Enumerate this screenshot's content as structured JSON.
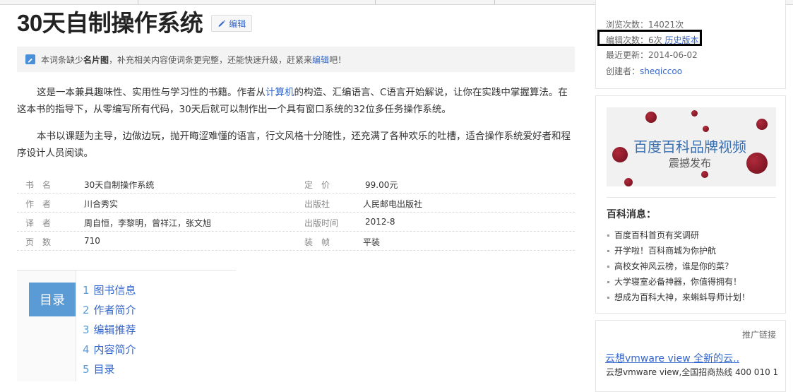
{
  "page": {
    "title": "30天自制操作系统",
    "edit_label": "编辑"
  },
  "notice": {
    "prefix": "本词条缺少",
    "bold": "名片图",
    "middle": "，补充相关内容使词条更完整，还能快速升级，赶紧来",
    "link": "编辑",
    "suffix": "吧！"
  },
  "intro": {
    "p1_before": "这是一本兼具趣味性、实用性与学习性的书籍。作者从",
    "p1_link": "计算机",
    "p1_after": "的构造、汇编语言、C语言开始解说，让你在实践中掌握算法。在这本书的指导下，从零编写所有代码，30天后就可以制作出一个具有窗口系统的32位多任务操作系统。",
    "p2": "本书以课题为主导，边做边玩，抛开晦涩难懂的语言，行文风格十分随性，还充满了各种欢乐的吐槽，适合操作系统爱好者和程序设计人员阅读。"
  },
  "book_info": [
    {
      "label1": "书　名",
      "value1": "30天自制操作系统",
      "label2": "定　价",
      "value2": "99.00元"
    },
    {
      "label1": "作　者",
      "value1": "川合秀实",
      "label2": "出版社",
      "value2": "人民邮电出版社"
    },
    {
      "label1": "译　者",
      "value1": "周自恒，李黎明，曾祥江，张文旭",
      "label2": "出版时间",
      "value2": "2012-8"
    },
    {
      "label1": "页　数",
      "value1": "710",
      "label2": "装　帧",
      "value2": "平装"
    }
  ],
  "toc": {
    "badge": "目录",
    "items": [
      {
        "num": "1",
        "label": "图书信息"
      },
      {
        "num": "2",
        "label": "作者简介"
      },
      {
        "num": "3",
        "label": "编辑推荐"
      },
      {
        "num": "4",
        "label": "内容简介"
      },
      {
        "num": "5",
        "label": "目录"
      }
    ]
  },
  "stats": {
    "views_label": "浏览次数：",
    "views_value": "14021次",
    "edits_label": "编辑次数：",
    "edits_value": "6次",
    "history_link": "历史版本",
    "updated_label": "最近更新：",
    "updated_value": "2014-06-02",
    "creator_label": "创建者：",
    "creator_value": "sheqiccoo"
  },
  "banner": {
    "line1": "百度百科品牌视频",
    "line2": "震撼发布"
  },
  "news": {
    "title": "百科消息：",
    "items": [
      "百度百科首页有奖调研",
      "开学啦！百科商城为你护航",
      "高校女神风云榜，谁是你的菜？",
      "大学寝室必备神器，你值得拥有！",
      "想成为百科大神，来蝌蚪导师计划！"
    ]
  },
  "ad": {
    "label": "推广链接",
    "link": "云想vmware view 全新的云..",
    "desc": "云想vmware view,全国招商热线 400 010 1"
  },
  "colors": {
    "link": "#3366cc",
    "toc_badge": "#5b9bd5",
    "highlight": "#000000"
  }
}
